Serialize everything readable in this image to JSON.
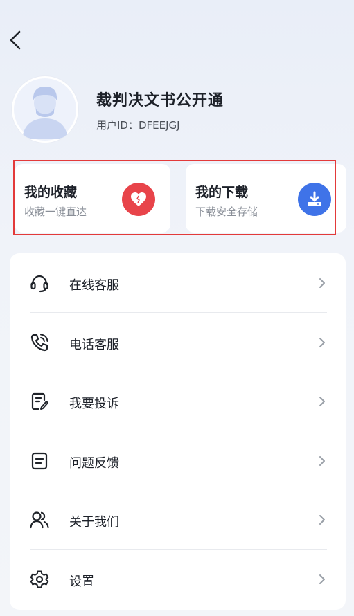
{
  "profile": {
    "name": "裁判决文书公开通",
    "uid_label": "用户ID：",
    "uid_value": "DFEEJGJ"
  },
  "quick_actions": [
    {
      "title": "我的收藏",
      "subtitle": "收藏一键直达",
      "icon": "heart-icon",
      "color": "#e8444a"
    },
    {
      "title": "我的下载",
      "subtitle": "下载安全存储",
      "icon": "download-icon",
      "color": "#3f73e8"
    }
  ],
  "menu": [
    {
      "label": "在线客服",
      "icon": "headset-icon"
    },
    {
      "label": "电话客服",
      "icon": "phone-icon"
    },
    {
      "label": "我要投诉",
      "icon": "complaint-icon"
    },
    {
      "label": "问题反馈",
      "icon": "feedback-icon"
    },
    {
      "label": "关于我们",
      "icon": "users-icon"
    },
    {
      "label": "设置",
      "icon": "gear-icon"
    }
  ],
  "colors": {
    "highlight_border": "#e33a3a",
    "favorite": "#e8444a",
    "download": "#3f73e8"
  }
}
